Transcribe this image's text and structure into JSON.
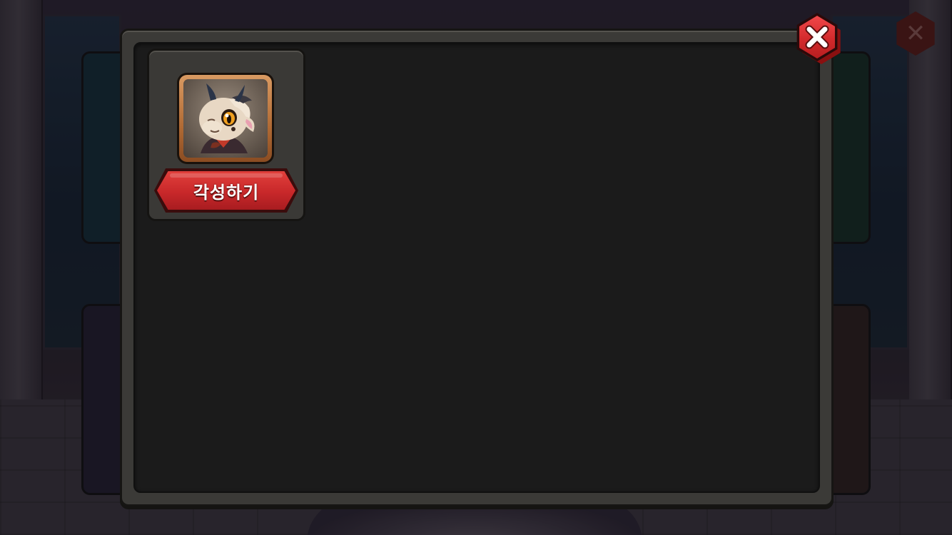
{
  "colors": {
    "panel": "#3b3a37",
    "panel_inner": "#1b1b1b",
    "close_red": "#d32a2c",
    "button_red": "#c8282a",
    "portrait_frame": "#b06a34"
  },
  "close_button": {
    "icon": "close-x-icon"
  },
  "background_close_button": {
    "icon": "close-x-icon"
  },
  "slots": [
    {
      "portrait": "dragon-character-portrait",
      "button_label": "각성하기"
    }
  ]
}
